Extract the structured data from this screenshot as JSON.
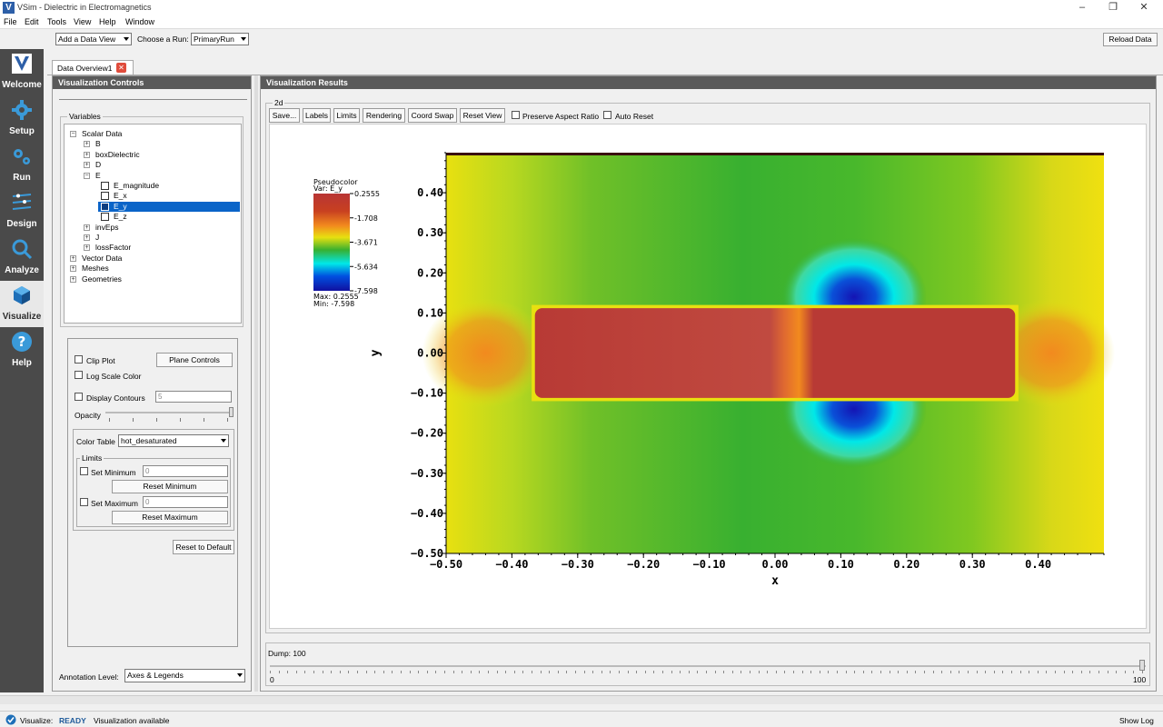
{
  "window": {
    "title": "VSim - Dielectric in Electromagnetics"
  },
  "menu": [
    "File",
    "Edit",
    "Tools",
    "View",
    "Help",
    "Window"
  ],
  "toolbar": {
    "add_view": "Add a Data View",
    "choose_run_label": "Choose a Run:",
    "run_value": "PrimaryRun",
    "reload": "Reload Data"
  },
  "sidebar": [
    {
      "label": "Welcome",
      "icon": "v-logo-icon"
    },
    {
      "label": "Setup",
      "icon": "gear-icon"
    },
    {
      "label": "Run",
      "icon": "gears-icon"
    },
    {
      "label": "Design",
      "icon": "design-icon"
    },
    {
      "label": "Analyze",
      "icon": "magnifier-icon"
    },
    {
      "label": "Visualize",
      "icon": "cube-icon"
    },
    {
      "label": "Help",
      "icon": "question-icon"
    }
  ],
  "tab": {
    "label": "Data Overview1"
  },
  "controls": {
    "header": "Visualization Controls",
    "variables_label": "Variables",
    "tree": [
      {
        "label": "Scalar Data",
        "level": 0,
        "type": "minus"
      },
      {
        "label": "B",
        "level": 1,
        "type": "plus"
      },
      {
        "label": "boxDielectric",
        "level": 1,
        "type": "plus"
      },
      {
        "label": "D",
        "level": 1,
        "type": "plus"
      },
      {
        "label": "E",
        "level": 1,
        "type": "minus"
      },
      {
        "label": "E_magnitude",
        "level": 2,
        "type": "check"
      },
      {
        "label": "E_x",
        "level": 2,
        "type": "check"
      },
      {
        "label": "E_y",
        "level": 2,
        "type": "check",
        "selected": true
      },
      {
        "label": "E_z",
        "level": 2,
        "type": "check"
      },
      {
        "label": "invEps",
        "level": 1,
        "type": "plus"
      },
      {
        "label": "J",
        "level": 1,
        "type": "plus"
      },
      {
        "label": "lossFactor",
        "level": 1,
        "type": "plus"
      },
      {
        "label": "Vector Data",
        "level": 0,
        "type": "plus"
      },
      {
        "label": "Meshes",
        "level": 0,
        "type": "plus"
      },
      {
        "label": "Geometries",
        "level": 0,
        "type": "plus"
      }
    ],
    "clip_plot": "Clip Plot",
    "plane_controls": "Plane Controls",
    "log_scale": "Log Scale Color",
    "display_contours": "Display Contours",
    "contours_value": "5",
    "opacity": "Opacity",
    "color_table_label": "Color Table",
    "color_table_value": "hot_desaturated",
    "limits_label": "Limits",
    "set_minimum": "Set Minimum",
    "min_value": "0",
    "reset_minimum": "Reset Minimum",
    "set_maximum": "Set Maximum",
    "max_value": "0",
    "reset_maximum": "Reset Maximum",
    "reset_default": "Reset to Default",
    "annotation_label": "Annotation Level:",
    "annotation_value": "Axes & Legends"
  },
  "results": {
    "header": "Visualization Results",
    "group_label": "2d",
    "buttons": [
      "Save...",
      "Labels",
      "Limits",
      "Rendering",
      "Coord Swap",
      "Reset View"
    ],
    "preserve_aspect": "Preserve Aspect Ratio",
    "auto_reset": "Auto Reset",
    "dump_label": "Dump: 100",
    "slider_min": "0",
    "slider_max": "100",
    "slider_value": 1.0
  },
  "chart_data": {
    "type": "heatmap",
    "title": "",
    "xlabel": "x",
    "ylabel": "y",
    "xlim": [
      -0.5,
      0.5
    ],
    "ylim": [
      -0.5,
      0.5
    ],
    "x_ticks": [
      "−0.50",
      "−0.40",
      "−0.30",
      "−0.20",
      "−0.10",
      "0.00",
      "0.10",
      "0.20",
      "0.30",
      "0.40"
    ],
    "y_ticks": [
      "0.40",
      "0.30",
      "0.20",
      "0.10",
      "0.00",
      "−0.10",
      "−0.20",
      "−0.30",
      "−0.40",
      "−0.50"
    ],
    "legend": {
      "title": "Pseudocolor",
      "var": "Var: E_y",
      "ticks": [
        "0.2555",
        "-1.708",
        "-3.671",
        "-5.634",
        "-7.598"
      ],
      "max": "Max:  0.2555",
      "min": "Min: -7.598"
    },
    "colors": {
      "hot": "#b83a35",
      "orange": "#f28a1e",
      "yellow": "#e8e010",
      "green": "#38b030",
      "cyan": "#00e8e8",
      "blue": "#1414b4"
    }
  },
  "status": {
    "label": "Visualize:",
    "state": "READY",
    "message": "Visualization available",
    "show_log": "Show Log"
  }
}
